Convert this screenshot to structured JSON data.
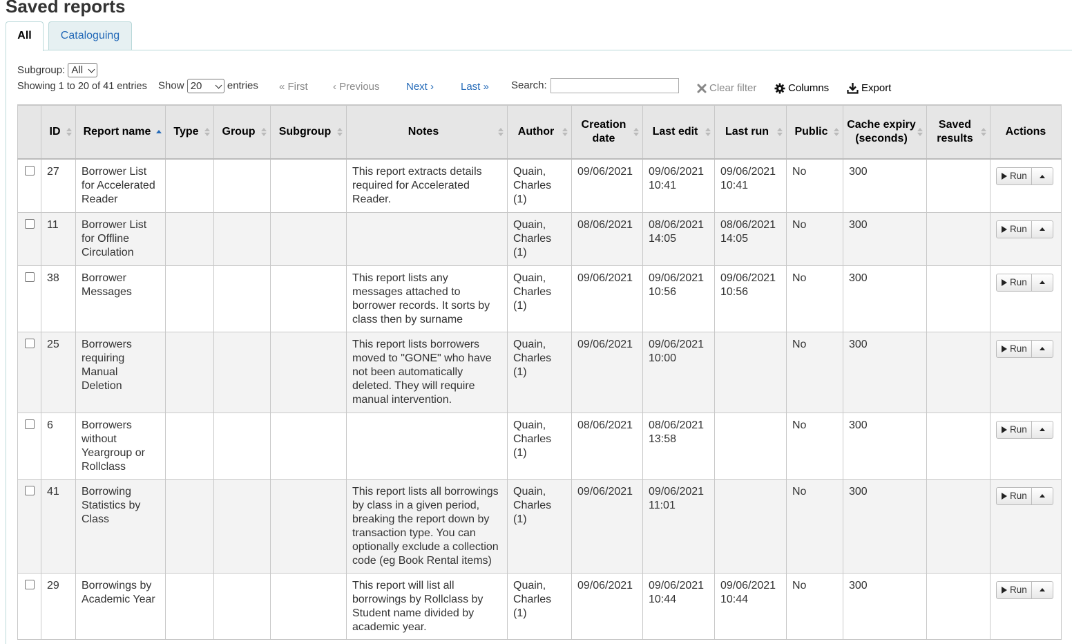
{
  "page": {
    "title": "Saved reports"
  },
  "tabs": [
    {
      "label": "All"
    },
    {
      "label": "Cataloguing"
    }
  ],
  "filters": {
    "subgroup_label": "Subgroup:",
    "subgroup_value": "All",
    "info": "Showing 1 to 20 of 41 entries",
    "show_label": "Show",
    "show_value": "20",
    "entries_label": "entries",
    "search_label": "Search:",
    "search_value": ""
  },
  "pager": {
    "first": "« First",
    "previous": "‹ Previous",
    "next": "Next ›",
    "last": "Last »"
  },
  "toolbar": {
    "clear_filter": "Clear filter",
    "columns": "Columns",
    "export": "Export"
  },
  "icons": {
    "clear": "close-icon",
    "columns": "gear-icon",
    "export": "download-icon",
    "run": "play-icon",
    "toggle": "caret-up-icon"
  },
  "table": {
    "columns": {
      "id": "ID",
      "report_name": "Report name",
      "type": "Type",
      "group": "Group",
      "subgroup": "Subgroup",
      "notes": "Notes",
      "author": "Author",
      "creation_date": "Creation date",
      "last_edit": "Last edit",
      "last_run": "Last run",
      "public": "Public",
      "cache_expiry": "Cache expiry (seconds)",
      "saved_results": "Saved results",
      "actions": "Actions"
    },
    "run_label": "Run",
    "rows": [
      {
        "id": "27",
        "name": "Borrower List for Accelerated Reader",
        "type": "",
        "group": "",
        "subgroup": "",
        "notes": "This report extracts details required for Accelerated Reader.",
        "author": "Quain, Charles (1)",
        "created": "09/06/2021",
        "last_edit": "09/06/2021 10:41",
        "last_run": "09/06/2021 10:41",
        "public": "No",
        "cache": "300",
        "saved": ""
      },
      {
        "id": "11",
        "name": "Borrower List for Offline Circulation",
        "type": "",
        "group": "",
        "subgroup": "",
        "notes": "",
        "author": "Quain, Charles (1)",
        "created": "08/06/2021",
        "last_edit": "08/06/2021 14:05",
        "last_run": "08/06/2021 14:05",
        "public": "No",
        "cache": "300",
        "saved": ""
      },
      {
        "id": "38",
        "name": "Borrower Messages",
        "type": "",
        "group": "",
        "subgroup": "",
        "notes": "This report lists any messages attached to borrower records. It sorts by class then by surname",
        "author": "Quain, Charles (1)",
        "created": "09/06/2021",
        "last_edit": "09/06/2021 10:56",
        "last_run": "09/06/2021 10:56",
        "public": "No",
        "cache": "300",
        "saved": ""
      },
      {
        "id": "25",
        "name": "Borrowers requiring Manual Deletion",
        "type": "",
        "group": "",
        "subgroup": "",
        "notes": "This report lists borrowers moved to \"GONE\" who have not been automatically deleted. They will require manual intervention.",
        "author": "Quain, Charles (1)",
        "created": "09/06/2021",
        "last_edit": "09/06/2021 10:00",
        "last_run": "",
        "public": "No",
        "cache": "300",
        "saved": ""
      },
      {
        "id": "6",
        "name": "Borrowers without Yeargroup or Rollclass",
        "type": "",
        "group": "",
        "subgroup": "",
        "notes": "",
        "author": "Quain, Charles (1)",
        "created": "08/06/2021",
        "last_edit": "08/06/2021 13:58",
        "last_run": "",
        "public": "No",
        "cache": "300",
        "saved": ""
      },
      {
        "id": "41",
        "name": "Borrowing Statistics by Class",
        "type": "",
        "group": "",
        "subgroup": "",
        "notes": "This report lists all borrowings by class in a given period, breaking the report down by transaction type. You can optionally exclude a collection code (eg Book Rental items)",
        "author": "Quain, Charles (1)",
        "created": "09/06/2021",
        "last_edit": "09/06/2021 11:01",
        "last_run": "",
        "public": "No",
        "cache": "300",
        "saved": ""
      },
      {
        "id": "29",
        "name": "Borrowings by Academic Year",
        "type": "",
        "group": "",
        "subgroup": "",
        "notes": "This report will list all borrowings by Rollclass by Student name divided by academic year.",
        "author": "Quain, Charles (1)",
        "created": "09/06/2021",
        "last_edit": "09/06/2021 10:44",
        "last_run": "09/06/2021 10:44",
        "public": "No",
        "cache": "300",
        "saved": ""
      }
    ]
  }
}
